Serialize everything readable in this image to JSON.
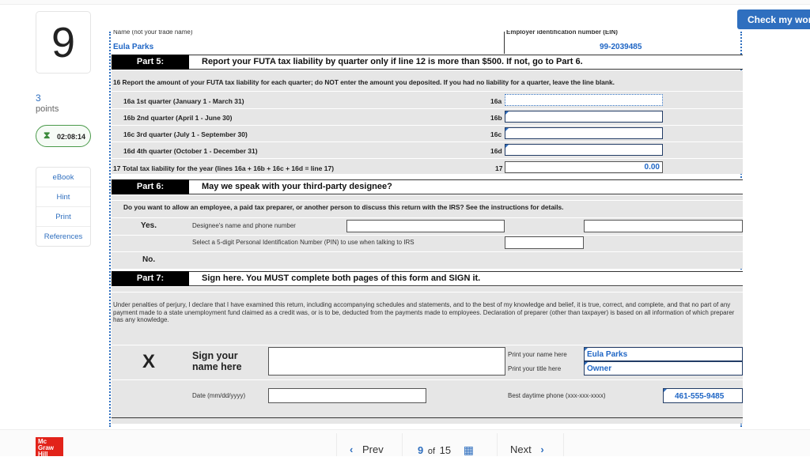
{
  "header": {
    "check_button": "Check my work"
  },
  "question": {
    "number": "9",
    "points_value": "3",
    "points_label": "points",
    "timer": "02:08:14",
    "tools": [
      "eBook",
      "Hint",
      "Print",
      "References"
    ]
  },
  "form": {
    "name_label": "Name (not your trade name)",
    "name_value": "Eula Parks",
    "ein_label": "Employer identification number (EIN)",
    "ein_value": "99-2039485",
    "part5": {
      "tag": "Part 5:",
      "title": "Report your FUTA tax liability by quarter only if line 12 is more than $500.  If not, go to Part 6.",
      "line16": "16 Report the amount of your FUTA tax liability for each quarter; do NOT enter the amount you deposited.  If you had no liability for a quarter, leave the line blank.",
      "quarters": [
        {
          "label": "16a   1st quarter (January 1 - March 31)",
          "code": "16a",
          "value": ""
        },
        {
          "label": "16b  2nd quarter (April 1 - June 30)",
          "code": "16b",
          "value": ""
        },
        {
          "label": "16c  3rd quarter (July 1 - September 30)",
          "code": "16c",
          "value": ""
        },
        {
          "label": "16d  4th quarter (October 1 - December 31)",
          "code": "16d",
          "value": ""
        }
      ],
      "line17_label": "17 Total tax liability for the year (lines 16a + 16b + 16c + 16d = line 17)",
      "line17_code": "17",
      "line17_value": "0.00"
    },
    "part6": {
      "tag": "Part 6:",
      "title": "May we speak with your third-party designee?",
      "question": "Do you want to allow an employee, a paid tax preparer, or another person to discuss this return with the IRS?  See the instructions for details.",
      "yes": "Yes.",
      "no": "No.",
      "designee_label": "Designee's name and phone number",
      "pin_label": "Select a 5-digit Personal Identification Number (PIN) to use when talking to IRS"
    },
    "part7": {
      "tag": "Part 7:",
      "title": "Sign here.  You MUST complete both pages of this form and SIGN it.",
      "declaration": "Under penalties of perjury, I declare that I have examined this return, including accompanying schedules and statements, and to the best of my knowledge and belief, it is true, correct, and complete, and that no part of any payment made to a state unemployment fund claimed as a credit was, or is to be, deducted from the payments made to employees. Declaration of preparer (other than taxpayer) is based on all information of which preparer has any knowledge.",
      "x_mark": "X",
      "sign_label": "Sign your name here",
      "print_name_label": "Print your name here",
      "print_name_value": "Eula Parks",
      "print_title_label": "Print your title here",
      "print_title_value": "Owner",
      "date_label": "Date (mm/dd/yyyy)",
      "phone_label": "Best daytime phone (xxx-xxx-xxxx)",
      "phone_value": "461-555-9485"
    }
  },
  "footer": {
    "logo": "Mc Graw Hill",
    "prev": "Prev",
    "current": "9",
    "of": "of",
    "total": "15",
    "next": "Next"
  }
}
